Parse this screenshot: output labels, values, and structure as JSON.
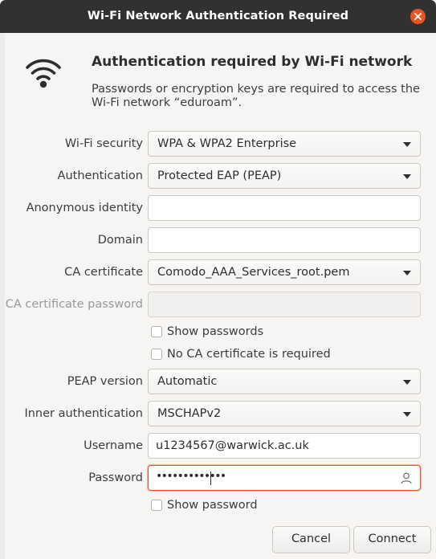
{
  "window": {
    "title": "Wi-Fi Network Authentication Required"
  },
  "header": {
    "heading": "Authentication required by Wi-Fi network",
    "description": "Passwords or encryption keys are required to access the Wi-Fi network “eduroam”."
  },
  "form": {
    "wifi_security": {
      "label": "Wi-Fi security",
      "value": "WPA & WPA2 Enterprise"
    },
    "authentication": {
      "label": "Authentication",
      "value": "Protected EAP (PEAP)"
    },
    "anonymous_identity": {
      "label": "Anonymous identity",
      "value": ""
    },
    "domain": {
      "label": "Domain",
      "value": ""
    },
    "ca_certificate": {
      "label": "CA certificate",
      "value": "Comodo_AAA_Services_root.pem"
    },
    "ca_certificate_password": {
      "label": "CA certificate password",
      "value": ""
    },
    "show_passwords": {
      "label": "Show passwords",
      "checked": false
    },
    "no_ca_required": {
      "label": "No CA certificate is required",
      "checked": false
    },
    "peap_version": {
      "label": "PEAP version",
      "value": "Automatic"
    },
    "inner_authentication": {
      "label": "Inner authentication",
      "value": "MSCHAPv2"
    },
    "username": {
      "label": "Username",
      "value": "u1234567@warwick.ac.uk"
    },
    "password": {
      "label": "Password",
      "value": "•••••••••••••"
    },
    "show_password": {
      "label": "Show password",
      "checked": false
    }
  },
  "buttons": {
    "cancel": "Cancel",
    "connect": "Connect"
  },
  "colors": {
    "accent": "#e95420",
    "titlebar": "#313131",
    "background": "#f6f5f4"
  },
  "icons": {
    "network": "wifi-icon",
    "close": "close-icon",
    "dropdown": "chevron-down-icon",
    "person": "person-icon"
  }
}
